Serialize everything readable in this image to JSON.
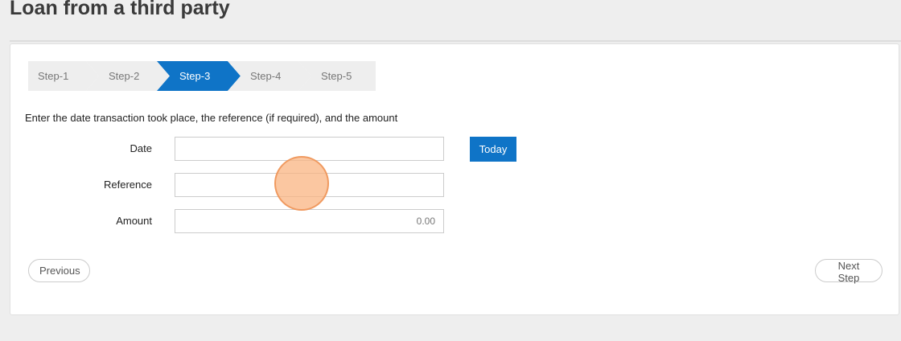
{
  "page": {
    "title": "Loan from a third party"
  },
  "wizard": {
    "steps": [
      {
        "label": "Step-1"
      },
      {
        "label": "Step-2"
      },
      {
        "label": "Step-3",
        "active": true
      },
      {
        "label": "Step-4"
      },
      {
        "label": "Step-5"
      }
    ],
    "accent_color": "#0f74c7"
  },
  "form": {
    "instruction": "Enter the date transaction took place, the reference (if required), and the amount",
    "date": {
      "label": "Date",
      "value": ""
    },
    "reference": {
      "label": "Reference",
      "value": ""
    },
    "amount": {
      "label": "Amount",
      "value": "0.00"
    },
    "today_label": "Today"
  },
  "footer": {
    "previous_label": "Previous",
    "next_label": "Next Step"
  }
}
